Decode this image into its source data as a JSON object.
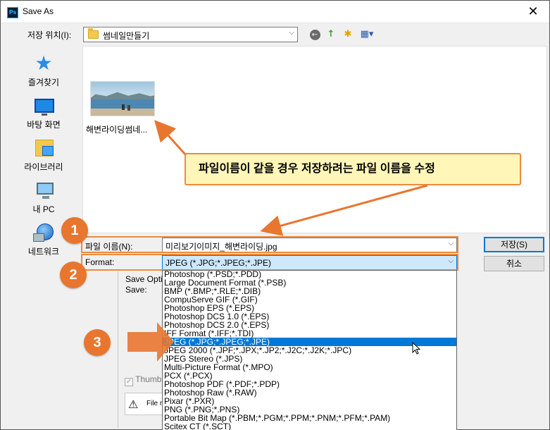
{
  "window": {
    "title": "Save As",
    "app_icon": "Ps",
    "close": "✕"
  },
  "location": {
    "label": "저장 위치(I):",
    "value": "썸네일만들기"
  },
  "toolbar": {
    "back": "←",
    "up": "↑",
    "new_folder": "✱",
    "view_menu": "▦▾"
  },
  "places": [
    {
      "label": "즐겨찾기",
      "icon": "star-icon"
    },
    {
      "label": "바탕 화면",
      "icon": "desktop-icon"
    },
    {
      "label": "라이브러리",
      "icon": "library-icon"
    },
    {
      "label": "내 PC",
      "icon": "pc-icon"
    },
    {
      "label": "네트워크",
      "icon": "network-icon"
    }
  ],
  "files": [
    {
      "name": "해변라이딩썸네..."
    }
  ],
  "callout": {
    "text": "파일이름이 같을 경우 저장하려는 파일 이름을 수정"
  },
  "filename": {
    "label": "파일 이름(N):",
    "value": "미리보기이미지_해변라이딩.jpg"
  },
  "format": {
    "label": "Format:",
    "value": "JPEG (*.JPG;*.JPEG;*.JPE)"
  },
  "buttons": {
    "save": "저장(S)",
    "cancel": "취소"
  },
  "options": {
    "title": "Save Opti",
    "save_label": "Save:",
    "thumbnail_label": "Thumb",
    "warning_text": "File n"
  },
  "format_options": [
    "Photoshop (*.PSD;*.PDD)",
    "Large Document Format (*.PSB)",
    "BMP (*.BMP;*.RLE;*.DIB)",
    "CompuServe GIF (*.GIF)",
    "Photoshop EPS (*.EPS)",
    "Photoshop DCS 1.0 (*.EPS)",
    "Photoshop DCS 2.0 (*.EPS)",
    "IFF Format (*.IFF;*.TDI)",
    "JPEG (*.JPG;*.JPEG;*.JPE)",
    "JPEG 2000 (*.JPF;*.JPX;*.JP2;*.J2C;*.J2K;*.JPC)",
    "JPEG Stereo (*.JPS)",
    "Multi-Picture Format (*.MPO)",
    "PCX (*.PCX)",
    "Photoshop PDF (*.PDF;*.PDP)",
    "Photoshop Raw (*.RAW)",
    "Pixar (*.PXR)",
    "PNG (*.PNG;*.PNS)",
    "Portable Bit Map (*.PBM;*.PGM;*.PPM;*.PNM;*.PFM;*.PAM)",
    "Scitex CT (*.SCT)"
  ],
  "selected_format_index": 8,
  "badges": [
    "1",
    "2",
    "3"
  ],
  "colors": {
    "accent": "#0078d7",
    "annotation": "#e8762f",
    "callout_bg": "#fff6b8"
  }
}
